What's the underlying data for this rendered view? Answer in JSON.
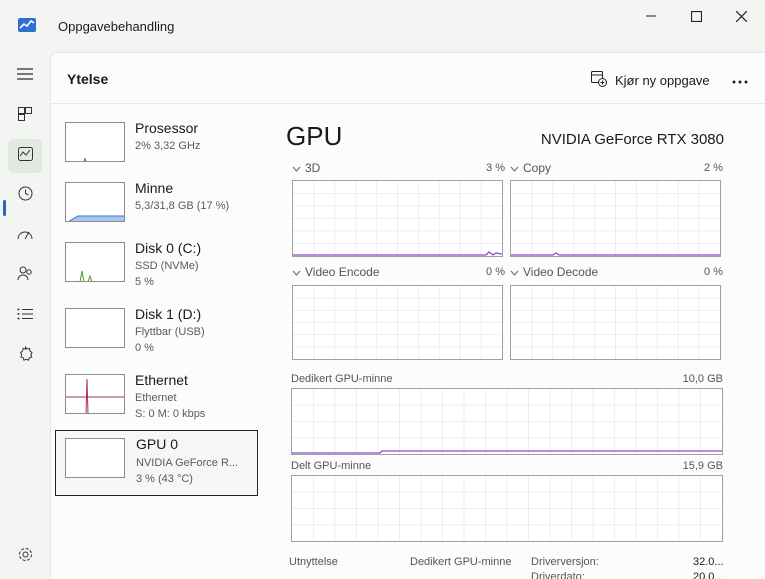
{
  "window": {
    "title": "Oppgavebehandling",
    "colors": {
      "accent": "#2a6bb8",
      "gpu_line": "#8a4cc8",
      "disk_line": "#4c9a2a",
      "memory_fill": "#a9c7e8",
      "ethernet_line": "#a8325a",
      "processor_line": "#3a78c8"
    }
  },
  "nav": {
    "icons": [
      "hamburger-icon",
      "processes-icon",
      "performance-icon",
      "app-history-icon",
      "startup-icon",
      "users-icon",
      "details-icon",
      "services-icon",
      "settings-icon"
    ]
  },
  "header": {
    "title": "Ytelse",
    "run_task_label": "Kjør ny oppgave",
    "more_label": "..."
  },
  "devices": [
    {
      "name": "Prosessor",
      "line1": "2%  3,32 GHz",
      "line2": ""
    },
    {
      "name": "Minne",
      "line1": "5,3/31,8 GB (17 %)",
      "line2": ""
    },
    {
      "name": "Disk 0 (C:)",
      "line1": "SSD (NVMe)",
      "line2": "5 %"
    },
    {
      "name": "Disk 1 (D:)",
      "line1": "Flyttbar (USB)",
      "line2": "0 %"
    },
    {
      "name": "Ethernet",
      "line1": "Ethernet",
      "line2": "S: 0  M: 0 kbps"
    },
    {
      "name": "GPU 0",
      "line1": "NVIDIA GeForce R...",
      "line2": "3 % (43 °C)"
    }
  ],
  "gpu": {
    "title": "GPU",
    "model": "NVIDIA GeForce RTX 3080",
    "engines": [
      {
        "name": "3D",
        "percent": "3 %"
      },
      {
        "name": "Copy",
        "percent": "2 %"
      },
      {
        "name": "Video Encode",
        "percent": "0 %"
      },
      {
        "name": "Video Decode",
        "percent": "0 %"
      }
    ],
    "dedicated_memory": {
      "label": "Dedikert GPU-minne",
      "max": "10,0 GB"
    },
    "shared_memory": {
      "label": "Delt GPU-minne",
      "max": "15,9 GB"
    },
    "stats": {
      "utilization_label": "Utnyttelse",
      "dedicated_label": "Dedikert GPU-minne",
      "driver_version_label": "Driverversjon:",
      "driver_version_value": "32.0...",
      "driver_date_label": "Driverdato:",
      "driver_date_value": "20.0..."
    }
  }
}
